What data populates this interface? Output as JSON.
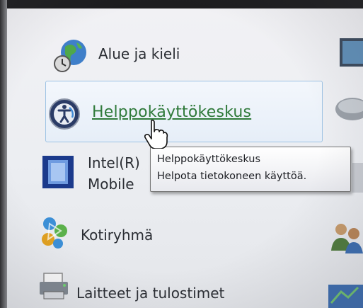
{
  "items": {
    "region": {
      "label": "Alue ja kieli",
      "icon": "globe-clock-icon"
    },
    "ease_of_access": {
      "label": "Helppokäyttökeskus",
      "icon": "ease-of-access-icon"
    },
    "intel": {
      "label_line1": "Intel(R)",
      "label_line2": "Mobile",
      "icon": "intel-graphics-icon"
    },
    "homegroup": {
      "label": "Kotiryhmä",
      "icon": "homegroup-icon"
    },
    "devices": {
      "label": "Laitteet ja tulostimet",
      "icon": "printer-icon"
    }
  },
  "tooltip": {
    "title": "Helppokäyttökeskus",
    "description": "Helpota tietokoneen käyttöä."
  },
  "colors": {
    "link": "#2f7a3a",
    "hover_border": "#9ec3e4",
    "background": "#eceef2"
  }
}
